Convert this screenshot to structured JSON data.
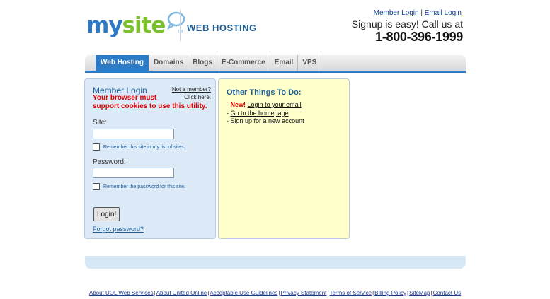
{
  "header": {
    "logo_my": "my",
    "logo_site": "site",
    "logo_tm": "TM",
    "subtitle": "WEB HOSTING",
    "member_login_link": "Member Login",
    "link_separator": "|",
    "email_login_link": "Email Login",
    "signup_text": "Signup is easy! Call us at",
    "phone": "1-800-396-1999"
  },
  "nav": {
    "tabs": [
      {
        "label": "Web Hosting",
        "active": true
      },
      {
        "label": "Domains",
        "active": false
      },
      {
        "label": "Blogs",
        "active": false
      },
      {
        "label": "E-Commerce",
        "active": false
      },
      {
        "label": "Email",
        "active": false
      },
      {
        "label": "VPS",
        "active": false
      }
    ]
  },
  "login": {
    "title": "Member Login",
    "not_member_line1": "Not a member?",
    "not_member_line2": "Click here.",
    "cookie_warning_line1": "Your browser must",
    "cookie_warning_line2": "support cookies to use this utility.",
    "site_label": "Site:",
    "site_value": "",
    "remember_site_label": "Remember this site in my list of sites.",
    "password_label": "Password:",
    "password_value": "",
    "remember_password_label": "Remember the password for this site.",
    "login_button": "Login!",
    "forgot_password": "Forgot password?"
  },
  "other": {
    "title": "Other Things To Do:",
    "bullet": "-",
    "new_badge": "New!",
    "items": [
      "Login to your email",
      "Go to the homepage",
      "Sign up for a new account"
    ]
  },
  "footer": {
    "separator": "|",
    "links": [
      "About UOL Web Services",
      "About United Online",
      "Acceptable Use Guidelines",
      "Privacy Statement",
      "Terms of Service",
      "Billing Policy",
      "SiteMap",
      "Contact Us"
    ]
  },
  "colors": {
    "brand_blue": "#2e79c3",
    "brand_green": "#7cbf2f",
    "nav_active": "#2c7bc4",
    "login_panel_bg": "#dce9f7",
    "other_panel_bg": "#ffffcc",
    "warning_red": "#e00000"
  }
}
